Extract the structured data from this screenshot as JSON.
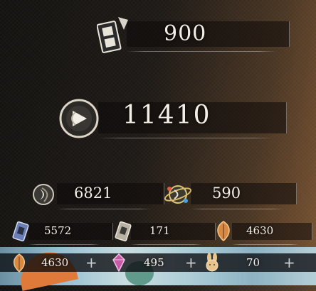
{
  "resources": {
    "film_tickets": {
      "icon": "film-ticket-icon",
      "value": "900"
    },
    "astral_orbs": {
      "icon": "astral-orb-icon",
      "value": "11410"
    },
    "row3": [
      {
        "icon": "crescent-moon-icon",
        "value": "6821"
      },
      {
        "icon": "ringed-planet-icon",
        "value": "590"
      }
    ],
    "row4": [
      {
        "icon": "blue-tape-icon",
        "value": "5572"
      },
      {
        "icon": "silver-tape-icon",
        "value": "171"
      },
      {
        "icon": "amber-leaf-icon",
        "value": "4630"
      }
    ],
    "row5": [
      {
        "icon": "amber-leaf-icon",
        "value": "4630",
        "action": "+"
      },
      {
        "icon": "pink-gem-icon",
        "value": "495",
        "action": "+"
      },
      {
        "icon": "bunny-token-icon",
        "value": "70",
        "action": "+"
      }
    ]
  },
  "colors": {
    "text": "#f4efe6",
    "accent_gold": "#d9b86a",
    "plate": "#0c0a09"
  }
}
